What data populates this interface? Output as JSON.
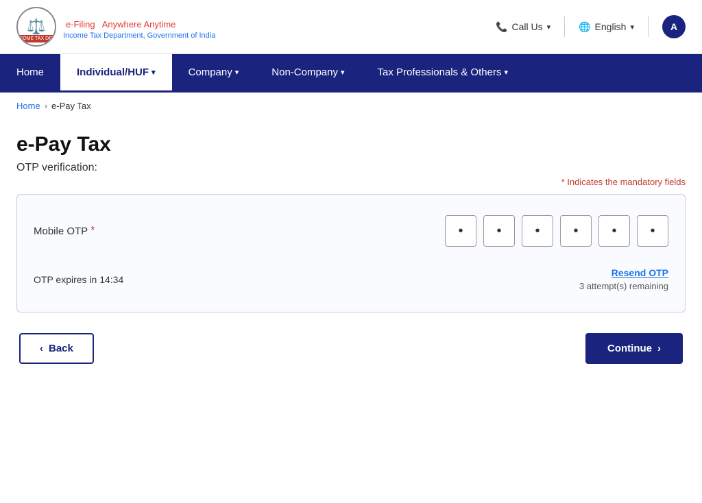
{
  "header": {
    "logo_efiling": "e-Filing",
    "logo_tagline": "Anywhere Anytime",
    "logo_subtitle": "Income Tax Department, Government of India",
    "call_us": "Call Us",
    "language": "English",
    "avatar_label": "A"
  },
  "nav": {
    "items": [
      {
        "id": "home",
        "label": "Home",
        "active": false,
        "has_dropdown": false
      },
      {
        "id": "individual-huf",
        "label": "Individual/HUF",
        "active": true,
        "has_dropdown": true
      },
      {
        "id": "company",
        "label": "Company",
        "active": false,
        "has_dropdown": true
      },
      {
        "id": "non-company",
        "label": "Non-Company",
        "active": false,
        "has_dropdown": true
      },
      {
        "id": "tax-professionals",
        "label": "Tax Professionals & Others",
        "active": false,
        "has_dropdown": true
      }
    ]
  },
  "breadcrumb": {
    "home": "Home",
    "current": "e-Pay Tax"
  },
  "page": {
    "title": "e-Pay Tax",
    "subtitle": "OTP verification:",
    "mandatory_note": "* Indicates the mandatory fields"
  },
  "otp_form": {
    "mobile_otp_label": "Mobile OTP",
    "required_marker": "*",
    "otp_dots": [
      "•",
      "•",
      "•",
      "•",
      "•",
      "•"
    ],
    "expiry_label": "OTP expires in 14:34",
    "resend_label": "Resend OTP",
    "attempts_label": "3 attempt(s) remaining"
  },
  "buttons": {
    "back_label": "Back",
    "continue_label": "Continue",
    "back_chevron": "‹",
    "continue_chevron": "›"
  }
}
